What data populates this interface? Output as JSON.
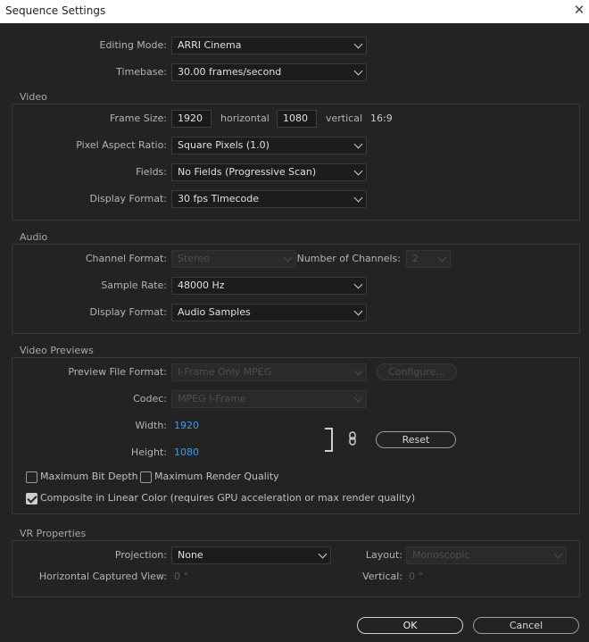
{
  "window": {
    "title": "Sequence Settings",
    "close_glyph": "✕"
  },
  "general": {
    "editing_mode": {
      "label": "Editing Mode:",
      "value": "ARRI Cinema"
    },
    "timebase": {
      "label": "Timebase:",
      "value": "30.00  frames/second"
    }
  },
  "video": {
    "title": "Video",
    "frame_size": {
      "label": "Frame Size:",
      "width": "1920",
      "horizontal_label": "horizontal",
      "height": "1080",
      "vertical_label": "vertical",
      "aspect": "16:9"
    },
    "pixel_aspect": {
      "label": "Pixel Aspect Ratio:",
      "value": "Square Pixels (1.0)"
    },
    "fields": {
      "label": "Fields:",
      "value": "No Fields (Progressive Scan)"
    },
    "display_format": {
      "label": "Display Format:",
      "value": "30 fps Timecode"
    }
  },
  "audio": {
    "title": "Audio",
    "channel_format": {
      "label": "Channel Format:",
      "value": "Stereo"
    },
    "num_channels": {
      "label": "Number of Channels:",
      "value": "2"
    },
    "sample_rate": {
      "label": "Sample Rate:",
      "value": "48000 Hz"
    },
    "display_format": {
      "label": "Display Format:",
      "value": "Audio Samples"
    }
  },
  "previews": {
    "title": "Video Previews",
    "file_format": {
      "label": "Preview File Format:",
      "value": "I-Frame Only MPEG"
    },
    "configure_label": "Configure...",
    "codec": {
      "label": "Codec:",
      "value": "MPEG I-Frame"
    },
    "width": {
      "label": "Width:",
      "value": "1920"
    },
    "height": {
      "label": "Height:",
      "value": "1080"
    },
    "reset_label": "Reset",
    "max_bit_depth": {
      "label": "Maximum Bit Depth",
      "checked": false
    },
    "max_render_quality": {
      "label": "Maximum Render Quality",
      "checked": false
    },
    "linear_color": {
      "label": "Composite in Linear Color (requires GPU acceleration or max render quality)",
      "checked": true
    }
  },
  "vr": {
    "title": "VR Properties",
    "projection": {
      "label": "Projection:",
      "value": "None"
    },
    "layout": {
      "label": "Layout:",
      "value": "Monoscopic"
    },
    "horizontal_view": {
      "label": "Horizontal Captured View:",
      "value": "0 °"
    },
    "vertical": {
      "label": "Vertical:",
      "value": "0 °"
    }
  },
  "buttons": {
    "ok": "OK",
    "cancel": "Cancel"
  },
  "icons": {
    "link": "link-icon",
    "close": "close-icon",
    "chevron": "chevron-down-icon"
  },
  "colors": {
    "background": "#232323",
    "link_value": "#3a9bff",
    "title_bar": "#ffffff"
  }
}
